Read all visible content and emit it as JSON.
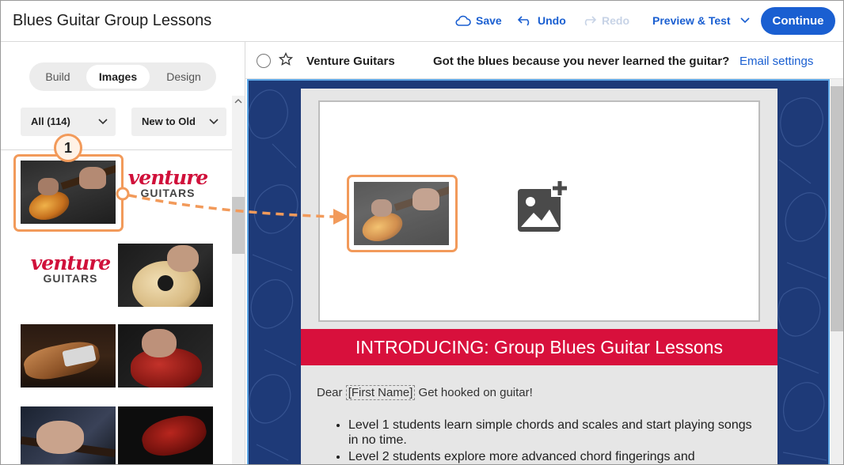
{
  "header": {
    "title": "Blues Guitar Group Lessons",
    "save_label": "Save",
    "undo_label": "Undo",
    "redo_label": "Redo",
    "preview_label": "Preview & Test",
    "continue_label": "Continue"
  },
  "sidebar": {
    "tabs": [
      "Build",
      "Images",
      "Design"
    ],
    "active_tab": "Images",
    "filter": "All (114)",
    "sort": "New to Old",
    "logo_line1": "venture",
    "logo_line2": "GUITARS",
    "step_badge": "1"
  },
  "subheader": {
    "from_name": "Venture Guitars",
    "subject": "Got the blues because you never learned the guitar?",
    "email_settings_label": "Email settings"
  },
  "email": {
    "banner": "INTRODUCING: Group Blues Guitar Lessons",
    "greeting_prefix": "Dear ",
    "merge_field": "[First Name]",
    "greeting_suffix": " Get hooked on guitar!",
    "bullets": [
      "Level 1 students learn simple chords and scales and start playing songs in no time.",
      "Level 2 students explore more advanced chord fingerings and"
    ]
  },
  "colors": {
    "accent": "#1a5fd1",
    "callout": "#f29a5a",
    "banner": "#d8103c",
    "canvas_bg": "#1e3a78"
  },
  "icons": [
    "cloud-save-icon",
    "undo-icon",
    "redo-icon",
    "chevron-down-icon",
    "star-icon",
    "add-image-icon"
  ]
}
